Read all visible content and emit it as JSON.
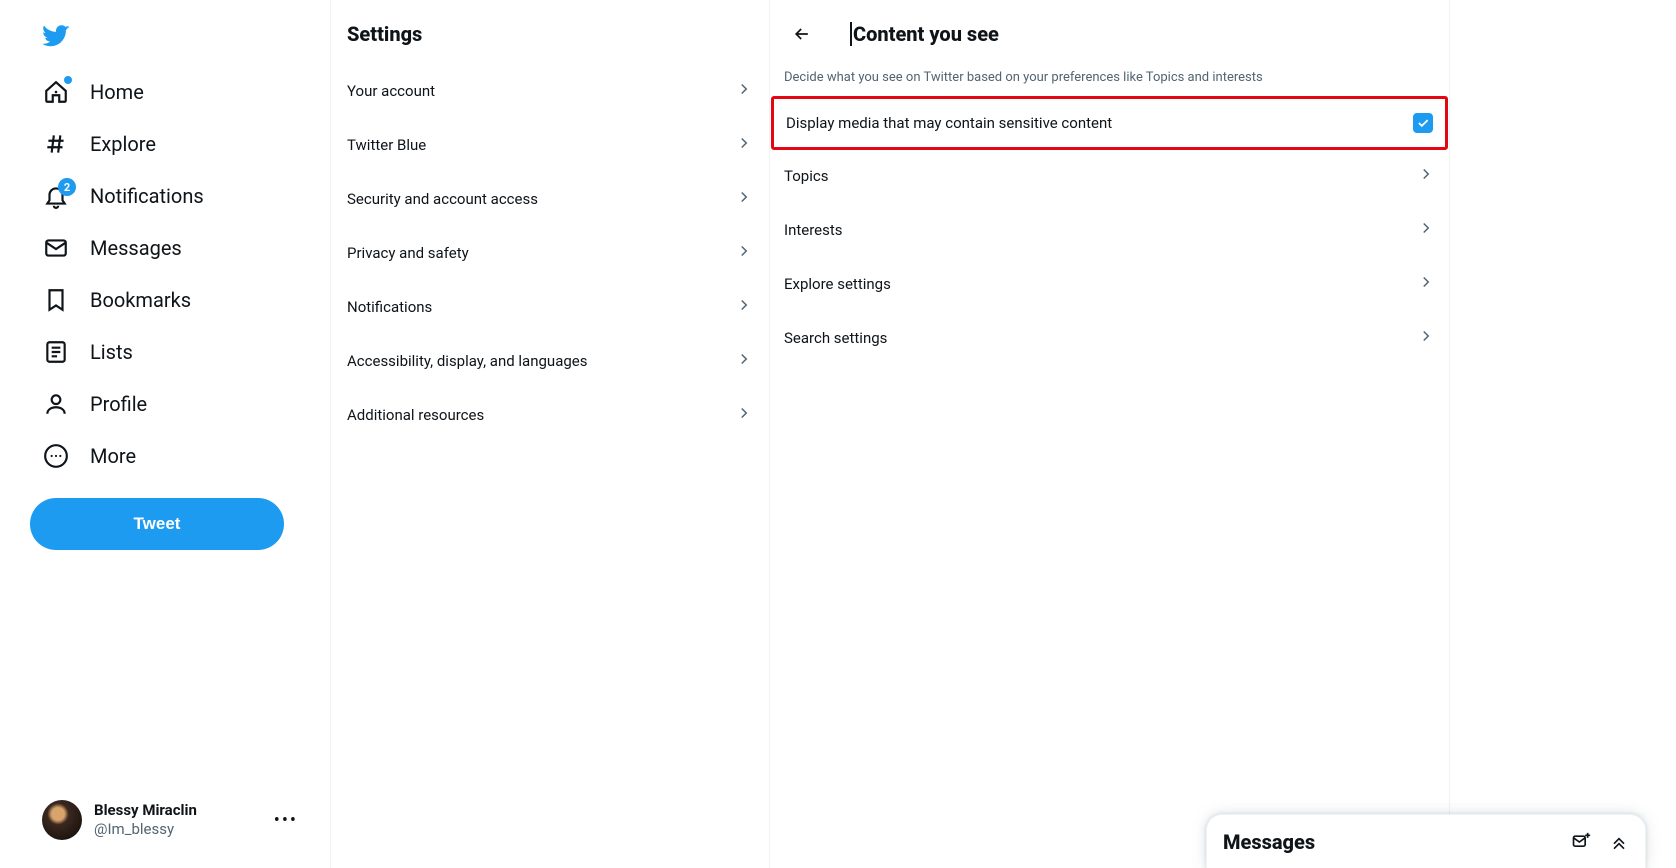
{
  "colors": {
    "accent": "#1d9bf0"
  },
  "sidebar": {
    "items": [
      {
        "label": "Home"
      },
      {
        "label": "Explore"
      },
      {
        "label": "Notifications",
        "badge": "2"
      },
      {
        "label": "Messages"
      },
      {
        "label": "Bookmarks"
      },
      {
        "label": "Lists"
      },
      {
        "label": "Profile"
      },
      {
        "label": "More"
      }
    ],
    "tweet_label": "Tweet"
  },
  "account": {
    "name": "Blessy Miraclin",
    "handle": "@Im_blessy"
  },
  "settings": {
    "title": "Settings",
    "items": [
      {
        "label": "Your account"
      },
      {
        "label": "Twitter Blue"
      },
      {
        "label": "Security and account access"
      },
      {
        "label": "Privacy and safety"
      },
      {
        "label": "Notifications"
      },
      {
        "label": "Accessibility, display, and languages"
      },
      {
        "label": "Additional resources"
      }
    ]
  },
  "content": {
    "title": "Content you see",
    "subtitle": "Decide what you see on Twitter based on your preferences like Topics and interests",
    "toggle_row": {
      "label": "Display media that may contain sensitive content",
      "checked": true
    },
    "rows": [
      {
        "label": "Topics"
      },
      {
        "label": "Interests"
      },
      {
        "label": "Explore settings"
      },
      {
        "label": "Search settings"
      }
    ]
  },
  "messages_dock": {
    "title": "Messages"
  }
}
